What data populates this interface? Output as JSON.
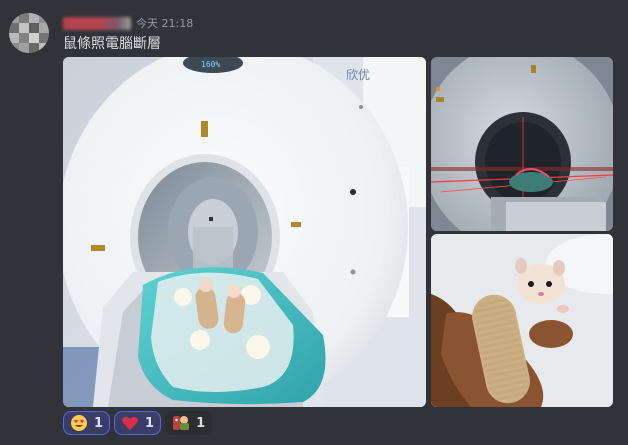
{
  "message": {
    "author": "username",
    "timestamp": "今天 21:18",
    "text": "鼠條照電腦斷層"
  },
  "reactions": [
    {
      "emoji": "heart-eyes-face-icon",
      "count": "1",
      "active": true
    },
    {
      "emoji": "red-heart-icon",
      "count": "1",
      "active": true
    },
    {
      "emoji": "custom-sticker-icon",
      "count": "1",
      "active": false
    }
  ],
  "attachments": [
    {
      "name": "ct-scanner-with-hamster-on-pillow"
    },
    {
      "name": "ct-scanner-red-laser"
    },
    {
      "name": "hamster-wrapped-in-bandage"
    }
  ],
  "image_texts": {
    "scanner_display": "160%",
    "scanner_brand": "欣优"
  },
  "colors": {
    "background": "#313338",
    "text": "#dbdee1",
    "timestamp": "#949ba4",
    "reaction_active_bg": "#393e68",
    "reaction_active_border": "#5865f2"
  }
}
